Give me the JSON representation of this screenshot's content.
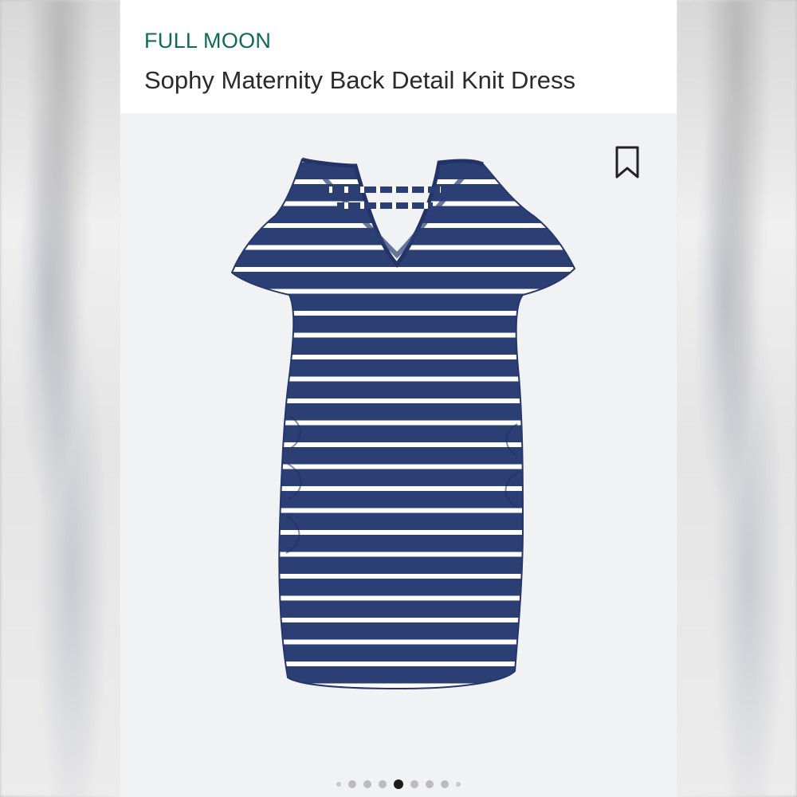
{
  "product": {
    "brand": "FULL MOON",
    "name": "Sophy Maternity Back Detail Knit Dress"
  },
  "colors": {
    "brand_text": "#0f6a5a",
    "dress_navy": "#2c3f74",
    "stripe": "#ffffff",
    "photo_background": "#f1f2f4"
  },
  "icons": {
    "bookmark": "bookmark-icon"
  },
  "carousel": {
    "total_dots": 9,
    "active_index": 4
  }
}
